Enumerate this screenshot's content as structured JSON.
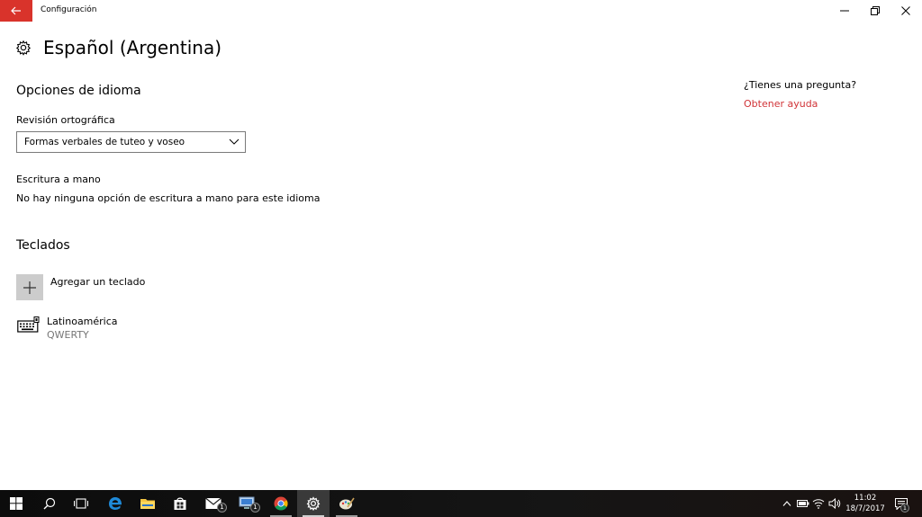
{
  "window": {
    "title": "Configuración",
    "back_icon": "back-arrow-icon",
    "accent_color": "#d9332b"
  },
  "page": {
    "title": "Español (Argentina)",
    "icon": "gear-icon"
  },
  "language_options": {
    "heading": "Opciones de idioma",
    "spellcheck_label": "Revisión ortográfica",
    "spellcheck_value": "Formas verbales de tuteo y voseo",
    "handwriting_label": "Escritura a mano",
    "handwriting_text": "No hay ninguna opción de escritura a mano para este idioma"
  },
  "keyboards": {
    "heading": "Teclados",
    "add_label": "Agregar un teclado",
    "items": [
      {
        "name": "Latinoamérica",
        "layout": "QWERTY"
      }
    ]
  },
  "help": {
    "question": "¿Tienes una pregunta?",
    "link": "Obtener ayuda",
    "link_color": "#d13438"
  },
  "taskbar": {
    "items": [
      "start-icon",
      "search-icon",
      "task-view-icon",
      "edge-icon",
      "file-explorer-icon",
      "store-icon",
      "mail-icon",
      "computer-icon",
      "chrome-icon",
      "settings-icon",
      "paint-icon"
    ],
    "mail_badge": "1",
    "computer_badge": "1",
    "time": "11:02",
    "date": "18/7/2017",
    "notification_badge": "1"
  }
}
